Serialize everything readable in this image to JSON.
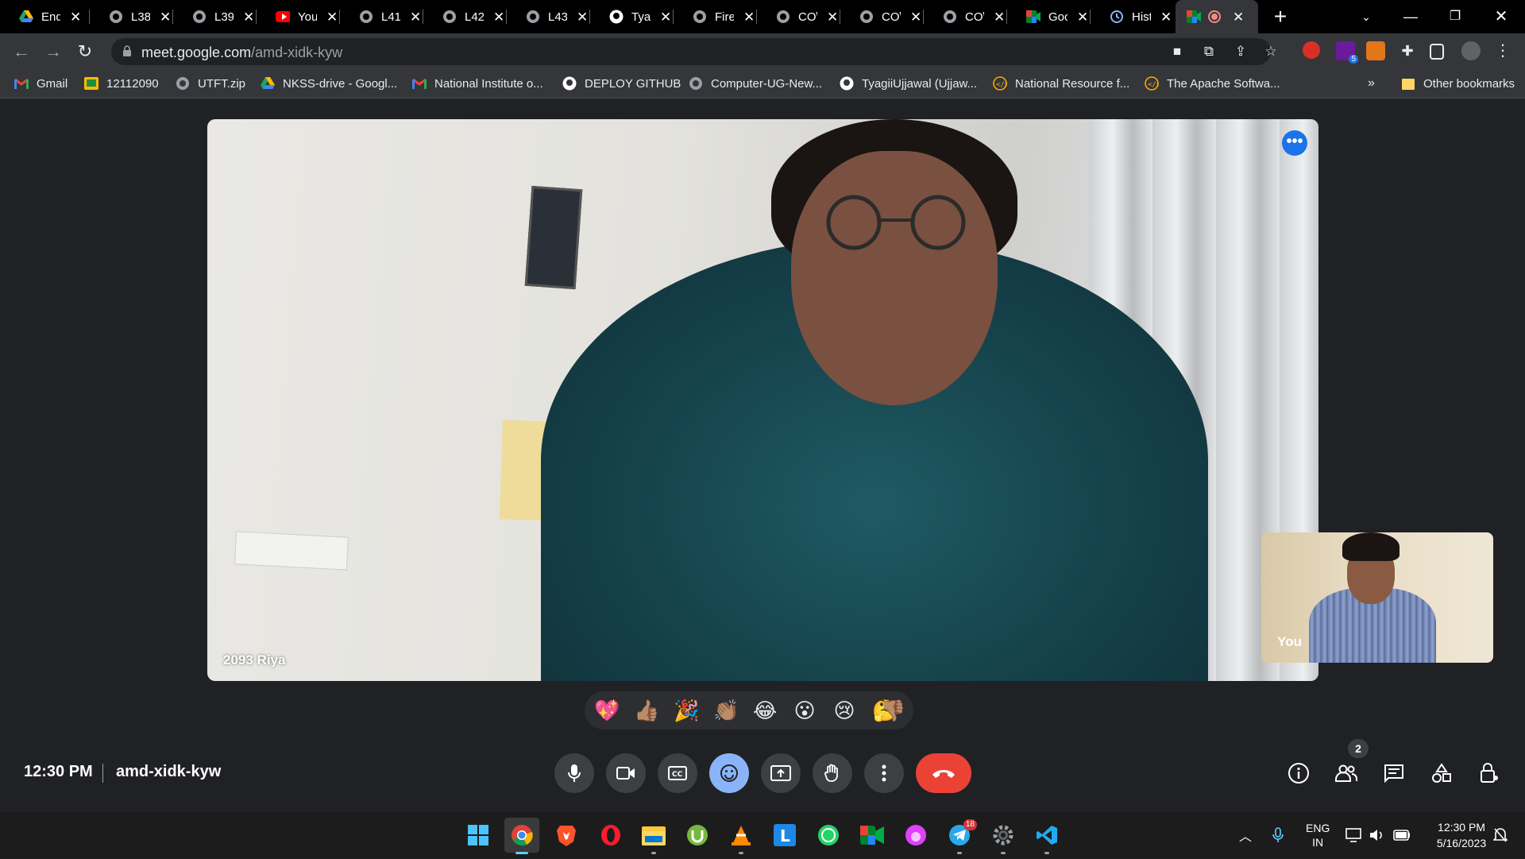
{
  "tabs": [
    {
      "title": "End",
      "icon": "google-drive-icon"
    },
    {
      "title": "L38",
      "icon": "globe-icon"
    },
    {
      "title": "L39",
      "icon": "globe-icon"
    },
    {
      "title": "You",
      "icon": "youtube-icon"
    },
    {
      "title": "L41",
      "icon": "globe-icon"
    },
    {
      "title": "L42",
      "icon": "globe-icon"
    },
    {
      "title": "L43",
      "icon": "globe-icon"
    },
    {
      "title": "Tya",
      "icon": "github-icon"
    },
    {
      "title": "Fire",
      "icon": "globe-icon"
    },
    {
      "title": "CO\\",
      "icon": "globe-icon"
    },
    {
      "title": "CO\\",
      "icon": "globe-icon"
    },
    {
      "title": "CO\\",
      "icon": "globe-icon"
    },
    {
      "title": "Goo",
      "icon": "google-meet-icon"
    },
    {
      "title": "Hist",
      "icon": "history-icon"
    },
    {
      "title": "",
      "icon": "recording-icon",
      "active": true
    }
  ],
  "address": {
    "host": "meet.google.com",
    "path": "/amd-xidk-kyw"
  },
  "extensions_badge": "5",
  "bookmarks": [
    {
      "label": "Gmail",
      "icon": "gmail-icon"
    },
    {
      "label": "12112090",
      "icon": "classroom-icon"
    },
    {
      "label": "UTFT.zip",
      "icon": "globe-icon"
    },
    {
      "label": "NKSS-drive - Googl...",
      "icon": "google-drive-icon"
    },
    {
      "label": "National Institute o...",
      "icon": "gmail-icon"
    },
    {
      "label": "DEPLOY GITHUB",
      "icon": "github-icon"
    },
    {
      "label": "Computer-UG-New...",
      "icon": "globe-icon"
    },
    {
      "label": "TyagiiUjjawal (Ujjaw...",
      "icon": "github-icon"
    },
    {
      "label": "National Resource f...",
      "icon": "code-icon"
    },
    {
      "label": "The Apache Softwa...",
      "icon": "code-icon"
    }
  ],
  "bookmarks_overflow": "»",
  "other_bookmarks": "Other bookmarks",
  "meet": {
    "main_participant": "2093 Riya",
    "self_label": "You",
    "time": "12:30 PM",
    "code": "amd-xidk-kyw",
    "people_count": "2",
    "reactions": [
      "💖",
      "👍🏽",
      "🎉",
      "👏🏽",
      "😂",
      "😮",
      "😢",
      "🤔",
      "👎🏽"
    ]
  },
  "taskbar": {
    "lang_top": "ENG",
    "lang_bottom": "IN",
    "time": "12:30 PM",
    "date": "5/16/2023",
    "telegram_badge": "18"
  },
  "colors": {
    "meet_bg": "#202124",
    "end_call": "#ea4335",
    "active_control": "#8ab4f8",
    "accent": "#1a73e8"
  }
}
